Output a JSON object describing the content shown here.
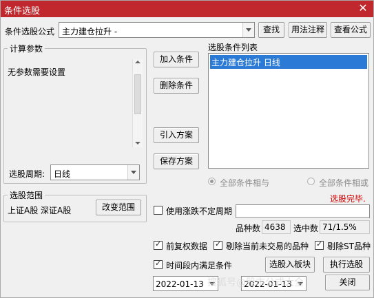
{
  "window": {
    "title": "条件选股",
    "close_glyph": "✕"
  },
  "formula": {
    "label": "条件选股公式",
    "value": "主力建仓拉升 -",
    "find": "查找",
    "usage": "用法注释",
    "view": "查看公式"
  },
  "params": {
    "title": "计算参数",
    "text": "无参数需要设置",
    "period_label": "选股周期:",
    "period_value": "日线"
  },
  "actions": {
    "add": "加入条件",
    "delete": "删除条件",
    "import": "引入方案",
    "save": "保存方案"
  },
  "condition_list": {
    "title": "选股条件列表",
    "items": [
      "主力建仓拉升  日线"
    ]
  },
  "logic": {
    "all_and": "全部条件相与",
    "all_or": "全部条件相或"
  },
  "status": {
    "text": "选股完毕.",
    "color": "#d00000"
  },
  "range": {
    "title": "选股范围",
    "value": "上证A股 深证A股",
    "change": "改变范围"
  },
  "irregular_period": {
    "label": "使用涨跌不定周期",
    "checked": false
  },
  "stats": {
    "count_label": "品种数",
    "count": "4638",
    "hit_label": "选中数",
    "hit": "71/1.5%"
  },
  "options": {
    "pre_adjust": {
      "label": "前复权数据",
      "checked": true
    },
    "exclude_untraded": {
      "label": "剔除当前未交易的品种",
      "checked": true
    },
    "exclude_st": {
      "label": "剔除ST品种",
      "checked": true
    },
    "period_condition": {
      "label": "时间段内满足条件",
      "checked": true
    }
  },
  "buttons": {
    "to_block": "选股入板块",
    "execute": "执行选股",
    "close": "关闭"
  },
  "dates": {
    "start": "2022-01-13",
    "end": "2022-01-13"
  },
  "watermark": "搜狐号@股市公式大全"
}
